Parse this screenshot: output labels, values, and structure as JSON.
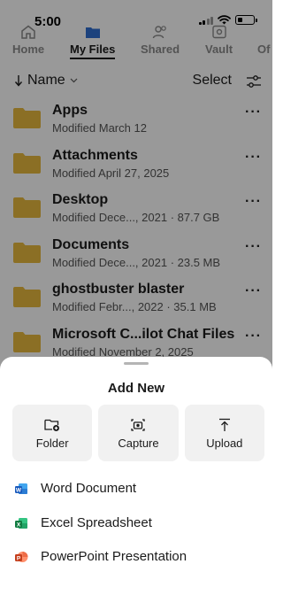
{
  "status": {
    "time": "5:00"
  },
  "tabs": [
    {
      "label": "Home",
      "icon": "home-icon",
      "active": false
    },
    {
      "label": "My Files",
      "icon": "folder-icon",
      "active": true
    },
    {
      "label": "Shared",
      "icon": "people-icon",
      "active": false
    },
    {
      "label": "Vault",
      "icon": "vault-icon",
      "active": false
    },
    {
      "label": "Of",
      "icon": "",
      "active": false
    }
  ],
  "sort": {
    "label": "Name",
    "select_label": "Select"
  },
  "files": [
    {
      "name": "Apps",
      "meta": "Modified March 12"
    },
    {
      "name": "Attachments",
      "meta": "Modified April 27, 2025"
    },
    {
      "name": "Desktop",
      "meta": "Modified Dece..., 2021 · 87.7 GB"
    },
    {
      "name": "Documents",
      "meta": "Modified Dece..., 2021 · 23.5 MB"
    },
    {
      "name": "ghostbuster blaster",
      "meta": "Modified Febr..., 2022 · 35.1 MB"
    },
    {
      "name": "Microsoft C...ilot Chat Files",
      "meta": "Modified November 2, 2025"
    }
  ],
  "sheet": {
    "title": "Add New",
    "quick_actions": [
      {
        "label": "Folder",
        "icon": "new-folder-icon"
      },
      {
        "label": "Capture",
        "icon": "camera-icon"
      },
      {
        "label": "Upload",
        "icon": "upload-icon"
      }
    ],
    "items": [
      {
        "label": "Word Document",
        "icon": "word-icon",
        "color": "#185abd"
      },
      {
        "label": "Excel Spreadsheet",
        "icon": "excel-icon",
        "color": "#107c41"
      },
      {
        "label": "PowerPoint Presentation",
        "icon": "powerpoint-icon",
        "color": "#c43e1c"
      }
    ]
  },
  "colors": {
    "folder": "#e8b93e",
    "overlay": "rgba(0,0,0,0.40)"
  }
}
